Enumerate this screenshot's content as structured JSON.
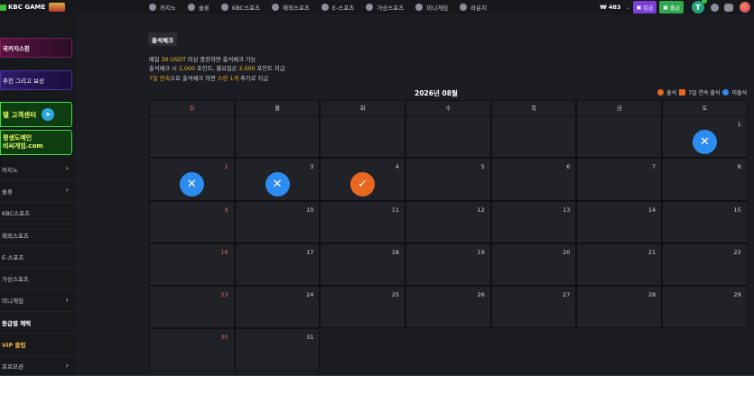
{
  "topbar": {
    "logo_text": "KBC GAME",
    "nav": [
      "카지노",
      "슬롯",
      "KBC스포츠",
      "해외스포츠",
      "E-스포츠",
      "가상스포츠",
      "미니게임",
      "라운지"
    ],
    "nav_icons": [
      "cards-icon",
      "slot-icon",
      "trophy-icon",
      "soccer-ball-icon",
      "gamepad-icon",
      "virtual-sports-icon",
      "dice-icon",
      "lounge-icon"
    ],
    "balance": "₩ 483",
    "deposit_label": "입금",
    "withdraw_label": "출금",
    "tether_symbol": "T"
  },
  "sidebar": {
    "promo_1": "국카지스핀",
    "promo_2": "추천 그리고 보상",
    "promo_3": "텔 고객센터",
    "promo_4_line1": "평생도메인",
    "promo_4_line2": "비씨게임.com",
    "menu": [
      {
        "label": "카지노",
        "arrow": true,
        "style": ""
      },
      {
        "label": "슬롯",
        "arrow": true,
        "style": ""
      },
      {
        "label": "KBC스포츠",
        "arrow": false,
        "style": ""
      },
      {
        "label": "해외스포츠",
        "arrow": false,
        "style": ""
      },
      {
        "label": "E-스포츠",
        "arrow": false,
        "style": ""
      },
      {
        "label": "가상스포츠",
        "arrow": false,
        "style": ""
      },
      {
        "label": "미니게임",
        "arrow": true,
        "style": ""
      },
      {
        "label": "등급별 혜택",
        "arrow": false,
        "style": "bold"
      },
      {
        "label": "VIP 클럽",
        "arrow": false,
        "style": "vip"
      },
      {
        "label": "프로모션",
        "arrow": true,
        "style": ""
      }
    ]
  },
  "main": {
    "title": "출석체크",
    "info_line1_a": "매일 ",
    "info_line1_b": "30 USDT",
    "info_line1_c": " 이상 충전하면 출석체크 가능",
    "info_line2_a": "출석체크 시 ",
    "info_line2_b": "1,000",
    "info_line2_c": " 포인트, 월요일은 ",
    "info_line2_d": "2,000",
    "info_line2_e": " 포인트 지급",
    "info_line3_a": "7일 연속",
    "info_line3_b": "으로 출석체크 하면 ",
    "info_line3_c": "스핀 1개",
    "info_line3_d": " 추가로 지급",
    "month": "2026년 08월",
    "legend": {
      "attended": "출석",
      "streak": "7일 연속 출석",
      "missed": "미출석",
      "colors": {
        "attended": "#e8681f",
        "streak": "#e8681f",
        "missed": "#2d8cf0"
      }
    },
    "weekdays": [
      "일",
      "월",
      "화",
      "수",
      "목",
      "금",
      "토"
    ],
    "days": [
      {
        "day": "",
        "mark": ""
      },
      {
        "day": "",
        "mark": ""
      },
      {
        "day": "",
        "mark": ""
      },
      {
        "day": "",
        "mark": ""
      },
      {
        "day": "",
        "mark": ""
      },
      {
        "day": "",
        "mark": ""
      },
      {
        "day": "1",
        "mark": "miss"
      },
      {
        "day": "2",
        "mark": "miss"
      },
      {
        "day": "3",
        "mark": "miss"
      },
      {
        "day": "4",
        "mark": "check"
      },
      {
        "day": "5",
        "mark": ""
      },
      {
        "day": "6",
        "mark": ""
      },
      {
        "day": "7",
        "mark": ""
      },
      {
        "day": "8",
        "mark": ""
      },
      {
        "day": "9",
        "mark": ""
      },
      {
        "day": "10",
        "mark": ""
      },
      {
        "day": "11",
        "mark": ""
      },
      {
        "day": "12",
        "mark": ""
      },
      {
        "day": "13",
        "mark": ""
      },
      {
        "day": "14",
        "mark": ""
      },
      {
        "day": "15",
        "mark": ""
      },
      {
        "day": "16",
        "mark": ""
      },
      {
        "day": "17",
        "mark": ""
      },
      {
        "day": "18",
        "mark": ""
      },
      {
        "day": "19",
        "mark": ""
      },
      {
        "day": "20",
        "mark": ""
      },
      {
        "day": "21",
        "mark": ""
      },
      {
        "day": "22",
        "mark": ""
      },
      {
        "day": "23",
        "mark": ""
      },
      {
        "day": "24",
        "mark": ""
      },
      {
        "day": "25",
        "mark": ""
      },
      {
        "day": "26",
        "mark": ""
      },
      {
        "day": "27",
        "mark": ""
      },
      {
        "day": "28",
        "mark": ""
      },
      {
        "day": "29",
        "mark": ""
      },
      {
        "day": "30",
        "mark": ""
      },
      {
        "day": "31",
        "mark": ""
      }
    ]
  }
}
